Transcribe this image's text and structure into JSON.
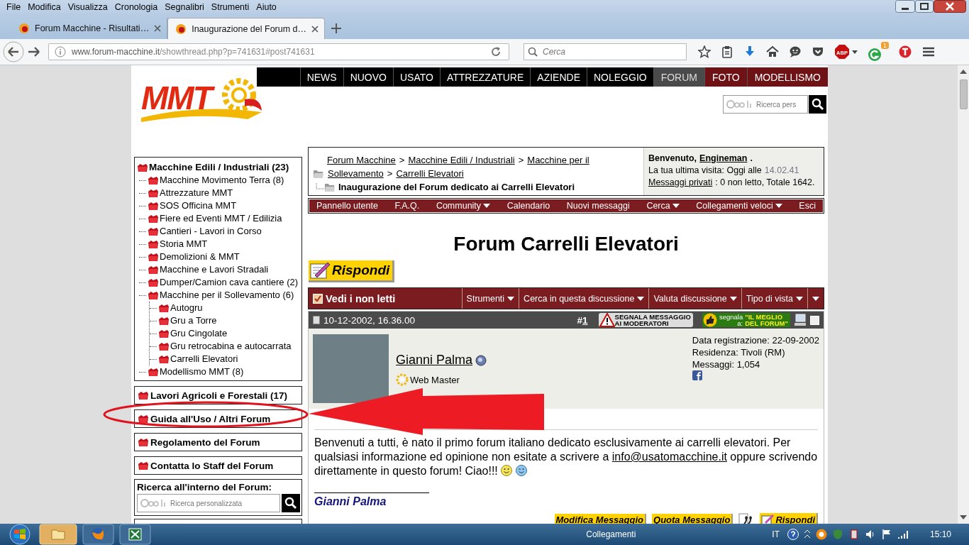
{
  "browser": {
    "menu": [
      "File",
      "Modifica",
      "Visualizza",
      "Cronologia",
      "Segnalibri",
      "Strumenti",
      "Aiuto"
    ],
    "tabs": [
      {
        "title": "Forum Macchine - Risultati…",
        "selected": false
      },
      {
        "title": "Inaugurazione del Forum d…",
        "selected": true
      }
    ],
    "address": {
      "domain": "www.forum-macchine.it",
      "path": "/showthread.php?p=741631#post741631"
    },
    "search": {
      "placeholder": "Cerca"
    },
    "adblock_label": "ABP",
    "extension_badge": "1"
  },
  "site": {
    "logo": "MMT",
    "nav": [
      {
        "label": "NEWS",
        "kind": "section",
        "selected": false
      },
      {
        "label": "NUOVO",
        "kind": "section",
        "selected": false
      },
      {
        "label": "USATO",
        "kind": "section",
        "selected": false
      },
      {
        "label": "ATTREZZATURE",
        "kind": "section",
        "selected": false
      },
      {
        "label": "AZIENDE",
        "kind": "section",
        "selected": false
      },
      {
        "label": "NOLEGGIO",
        "kind": "section",
        "selected": false
      },
      {
        "label": "FORUM",
        "kind": "community",
        "selected": true
      },
      {
        "label": "FOTO",
        "kind": "community",
        "selected": false
      },
      {
        "label": "MODELLISMO",
        "kind": "community",
        "selected": false
      }
    ],
    "search": {
      "placeholder": "Ricerca pers"
    }
  },
  "sidebar": {
    "tree": {
      "label": "Macchine Edili / Industriali (23)",
      "children": [
        {
          "label": "Macchine Movimento Terra (8)"
        },
        {
          "label": "Attrezzature MMT"
        },
        {
          "label": "SOS Officina MMT"
        },
        {
          "label": "Fiere ed Eventi MMT / Edilizia"
        },
        {
          "label": "Cantieri - Lavori in Corso"
        },
        {
          "label": "Storia MMT"
        },
        {
          "label": "Demolizioni & MMT"
        },
        {
          "label": "Macchine e Lavori Stradali"
        },
        {
          "label": "Dumper/Camion cava cantiere (2)"
        },
        {
          "label": "Macchine per il Sollevamento (6)",
          "children": [
            {
              "label": "Autogru"
            },
            {
              "label": "Gru a Torre"
            },
            {
              "label": "Gru Cingolate"
            },
            {
              "label": "Gru retrocabina e autocarrata"
            },
            {
              "label": "Carrelli Elevatori"
            }
          ]
        },
        {
          "label": "Modellismo MMT (8)"
        }
      ]
    },
    "sections": [
      "Lavori Agricoli e Forestali (17)",
      "Guida all'Uso / Altri Forum",
      "Regolamento del Forum",
      "Contatta lo Staff del Forum"
    ],
    "search": {
      "title": "Ricerca all'interno del Forum:",
      "placeholder": "Ricerca personalizzata"
    }
  },
  "breadcrumb": {
    "lines": [
      [
        {
          "text": "Forum Macchine",
          "kind": "link"
        },
        {
          "text": ">",
          "kind": "separator"
        },
        {
          "text": "Macchine Edili / Industriali",
          "kind": "link"
        },
        {
          "text": ">",
          "kind": "separator"
        },
        {
          "text": "Macchine per il",
          "kind": "link"
        }
      ],
      [
        {
          "text": "Sollevamento",
          "kind": "link"
        },
        {
          "text": ">",
          "kind": "separator"
        },
        {
          "text": "Carrelli Elevatori",
          "kind": "link"
        }
      ]
    ],
    "current": "Inaugurazione del Forum dedicato ai Carrelli Elevatori"
  },
  "welcome": {
    "greeting": "Benvenuto,",
    "user": "Engineman",
    "user_suffix": ".",
    "last_visit_label": "La tua ultima visita: Oggi alle",
    "last_visit_time": "14.02.41",
    "pm_link": "Messaggi privati",
    "pm_text": ": 0 non letto, Totale 1642."
  },
  "forum_nav": [
    {
      "label": "Pannello utente",
      "dropdown": false
    },
    {
      "label": "F.A.Q.",
      "dropdown": false
    },
    {
      "label": "Community",
      "dropdown": true
    },
    {
      "label": "Calendario",
      "dropdown": false
    },
    {
      "label": "Nuovi messaggi",
      "dropdown": false
    },
    {
      "label": "Cerca",
      "dropdown": true
    },
    {
      "label": "Collegamenti veloci",
      "dropdown": true
    },
    {
      "label": "Esci",
      "dropdown": false
    }
  ],
  "title": "Forum Carrelli Elevatori",
  "reply_button": "Rispondi",
  "thread_tools": {
    "unread": "Vedi i non letti",
    "menus": [
      "Strumenti",
      "Cerca in questa discussione",
      "Valuta discussione",
      "Tipo di vista"
    ]
  },
  "post": {
    "selected": false,
    "date": "10-12-2002, 16.36.00",
    "number_prefix": "#",
    "number": "1",
    "report_badge": [
      "SEGNALA MESSAGGIO",
      "AI MODERATORI"
    ],
    "best_badge": {
      "left": [
        "segnala",
        "a:"
      ],
      "right": [
        "\"IL MEGLIO",
        "DEL FORUM\""
      ]
    },
    "author": {
      "name": "Gianni Palma",
      "online": true,
      "rank": "Web Master",
      "info": [
        "Data registrazione: 22-09-2002",
        "Residenza: Tivoli (RM)",
        "Messaggi: 1,054"
      ]
    },
    "body_before": "Benvenuti a tutti, è nato il primo forum italiano dedicato esclusivamente ai carrelli elevatori. Per qualsiasi informazione ed opinione non esitate a scrivere a ",
    "email": "info@usatomacchine.it",
    "body_after": " oppure scrivendo direttamente in questo forum! Ciao!!! ",
    "signature": "Gianni Palma",
    "actions": [
      {
        "kind": "text",
        "label": "Modifica Messaggio"
      },
      {
        "kind": "text",
        "label": "Quota Messaggio"
      },
      {
        "kind": "multiquote"
      },
      {
        "kind": "reply",
        "label": "Rispondi"
      }
    ]
  },
  "taskbar": {
    "toolbar": "Collegamenti",
    "language": "IT",
    "clock": "15:10"
  }
}
